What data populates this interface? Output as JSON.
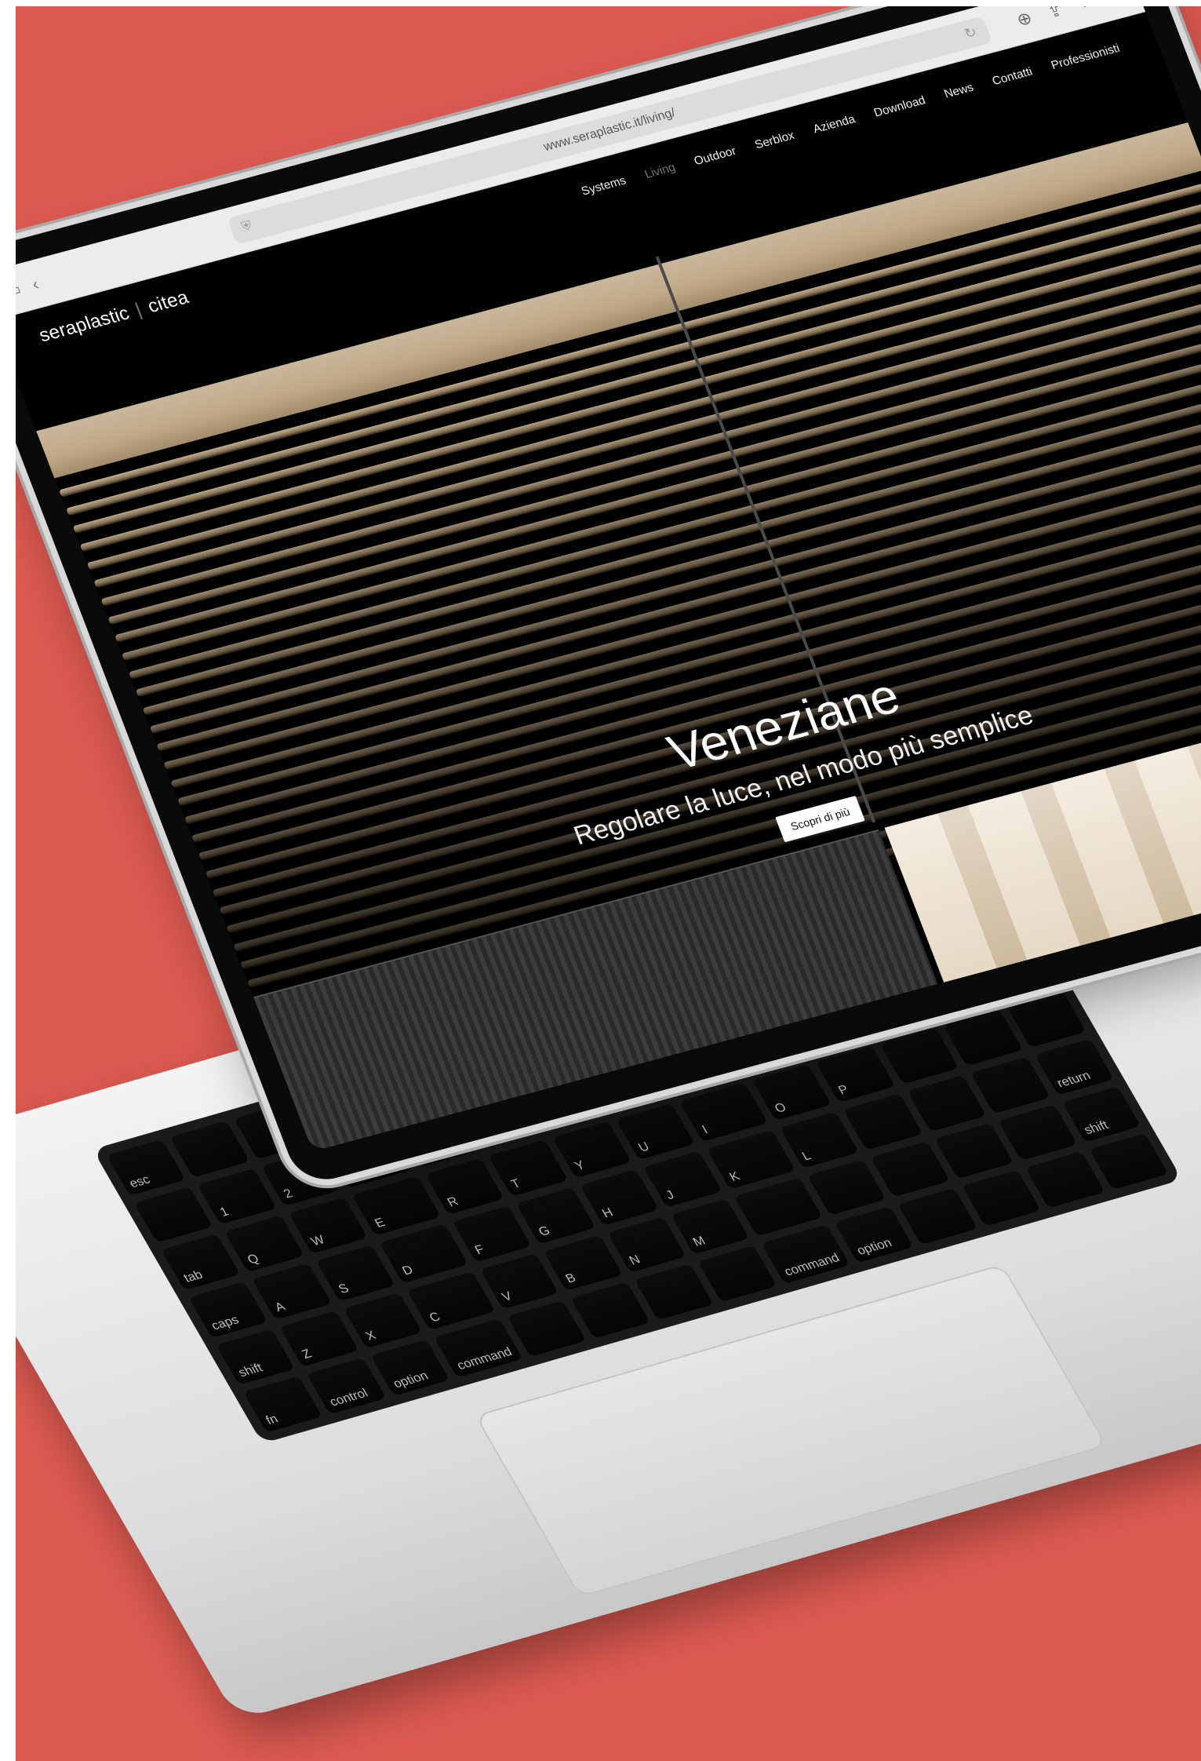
{
  "colors": {
    "background": "#de5b52",
    "screen_bg": "#000000",
    "blind_accent": "#c9b79a",
    "laptop_silver": "#e6e6e6"
  },
  "browser": {
    "url": "www.seraplastic.it/living/",
    "icons": [
      "sidebar-icon",
      "back-icon",
      "privacy-shield-icon",
      "reload-icon",
      "download-icon",
      "share-icon",
      "new-tab-icon",
      "tab-overview-icon"
    ]
  },
  "site": {
    "logo_primary": "seraplastic",
    "logo_secondary": "citea",
    "nav": [
      {
        "label": "Systems"
      },
      {
        "label": "Living"
      },
      {
        "label": "Outdoor"
      },
      {
        "label": "Serblox"
      },
      {
        "label": "Azienda"
      },
      {
        "label": "Download"
      },
      {
        "label": "News"
      },
      {
        "label": "Contatti"
      },
      {
        "label": "Professionisti"
      }
    ]
  },
  "hero": {
    "title": "Veneziane",
    "subtitle": "Regolare la luce, nel modo più semplice",
    "cta": "Scopri di più"
  }
}
